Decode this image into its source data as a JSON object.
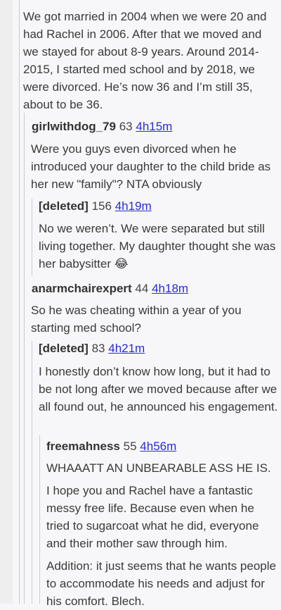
{
  "top_cut_text": "  ~~~~~~~~~~ ~~ ~~~~~~",
  "intro": {
    "text": "We got married in 2004 when we were 20 and had Rachel in 2006. After that we moved and we stayed for about 8-9 years. Around 2014-2015, I started med school and by 2018, we were divorced. He’s now 36 and I’m still 35, about to be 36."
  },
  "comments": [
    {
      "author": "girlwithdog_79",
      "score": "63",
      "time": "4h15m",
      "body": "Were you guys even divorced when he introduced your daughter to the child bride as her new \"family\"? NTA obviously"
    },
    {
      "author": "[deleted]",
      "score": "156",
      "time": "4h19m",
      "body": "No we weren’t. We were separated but still living together. My daughter thought she was her babysitter 😂"
    },
    {
      "author": "anarmchairexpert",
      "score": "44",
      "time": "4h18m",
      "body": "So he was cheating within a year of you starting med school?"
    },
    {
      "author": "[deleted]",
      "score": "83",
      "time": "4h21m",
      "body": "I honestly don’t know how long, but it had to be not long after we moved because after we all found out, he announced his engagement."
    },
    {
      "author": "freemahness",
      "score": "55",
      "time": "4h56m",
      "paragraphs": [
        "WHAAATT AN UNBEARABLE ASS HE IS.",
        "I hope you and Rachel have a fantastic messy free life. Because even when he tried to sugarcoat what he did, everyone and their mother saw through him.",
        "Addition: it just seems that he wants people to accommodate his needs and adjust for his comfort. Blech."
      ]
    }
  ]
}
